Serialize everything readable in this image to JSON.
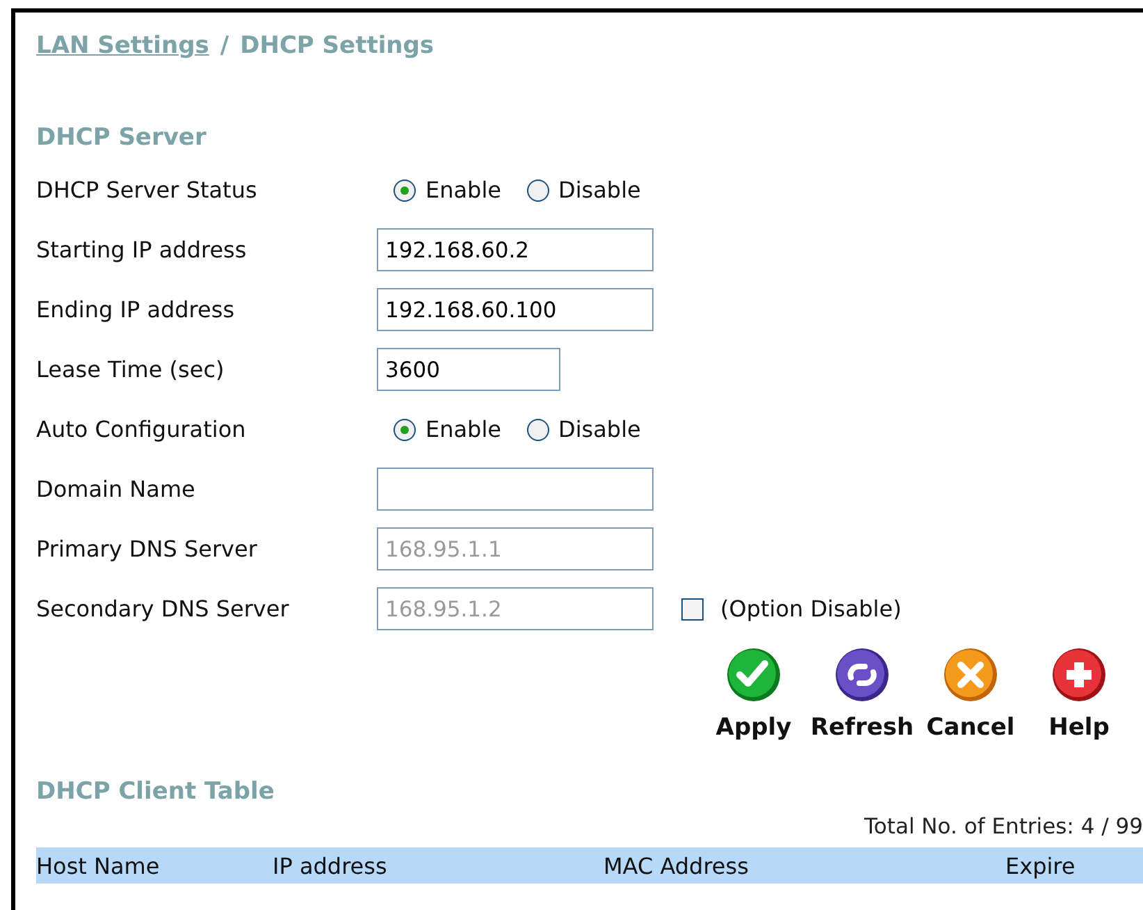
{
  "breadcrumb": {
    "link": "LAN Settings",
    "separator": "/",
    "current": "DHCP Settings"
  },
  "server_section": {
    "title": "DHCP Server"
  },
  "fields": [
    {
      "kind": "radio",
      "label": "DHCP Server Status",
      "options": [
        {
          "label": "Enable",
          "selected": true
        },
        {
          "label": "Disable",
          "selected": false
        }
      ]
    },
    {
      "kind": "text",
      "label": "Starting IP address",
      "value": "192.168.60.2",
      "disabled": false
    },
    {
      "kind": "text",
      "label": "Ending IP address",
      "value": "192.168.60.100",
      "disabled": false
    },
    {
      "kind": "shorttext",
      "label": "Lease Time (sec)",
      "value": "3600",
      "disabled": false
    },
    {
      "kind": "radio",
      "label": "Auto Configuration",
      "options": [
        {
          "label": "Enable",
          "selected": true
        },
        {
          "label": "Disable",
          "selected": false
        }
      ]
    },
    {
      "kind": "text",
      "label": "Domain Name"
    },
    {
      "kind": "text",
      "label": "Primary DNS Server",
      "value": "168.95.1.1",
      "disabled": true
    },
    {
      "kind": "text",
      "label": "Secondary DNS Server",
      "value": "168.95.1.2",
      "disabled": true,
      "checkbox": {
        "label": "(Option Disable)",
        "checked": false
      }
    }
  ],
  "actions": [
    {
      "kind": "apply",
      "label": "Apply"
    },
    {
      "kind": "refresh",
      "label": "Refresh"
    },
    {
      "kind": "cancel",
      "label": "Cancel"
    },
    {
      "kind": "help",
      "label": "Help"
    }
  ],
  "client_section": {
    "title": "DHCP Client Table",
    "total": "Total No. of Entries: 4 / 99"
  },
  "table": {
    "columns": [
      "Host Name",
      "IP address",
      "MAC Address",
      "Expire"
    ]
  }
}
